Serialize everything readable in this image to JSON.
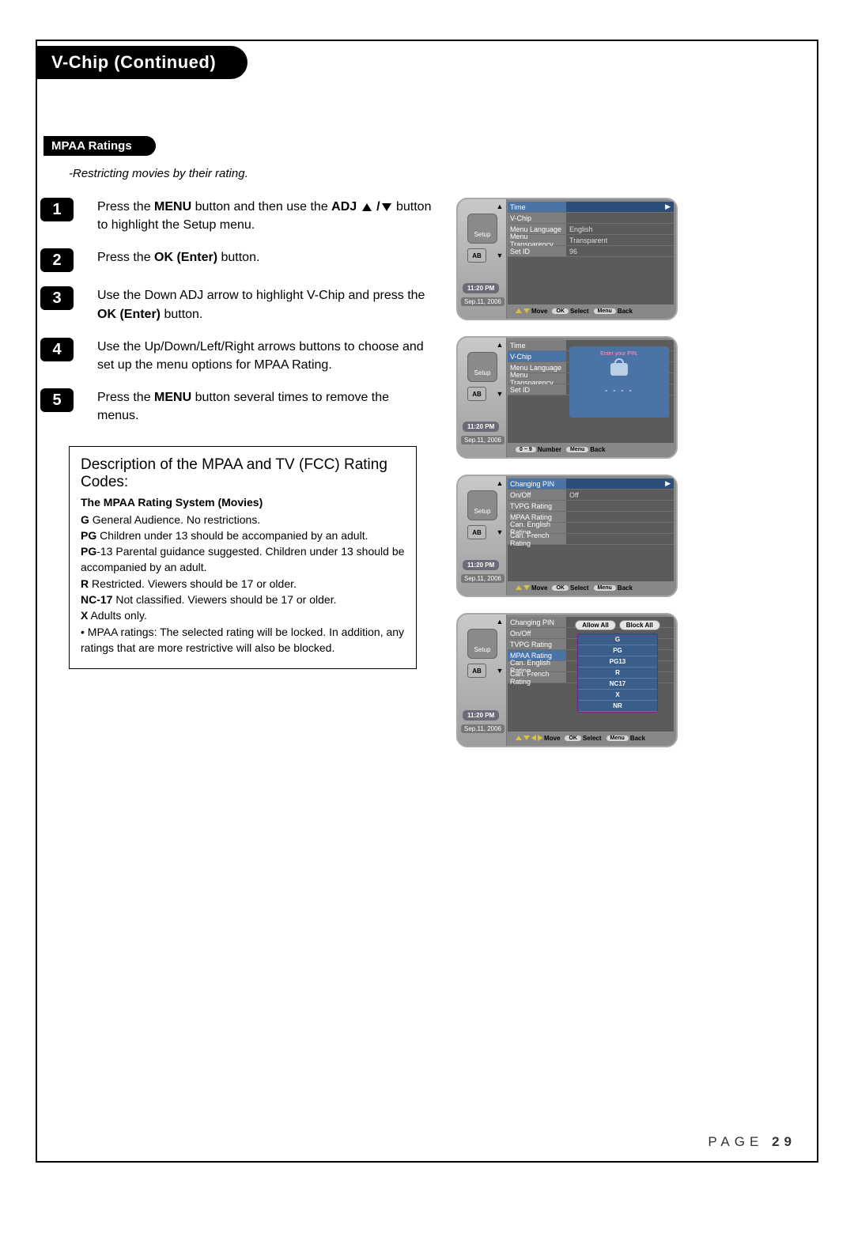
{
  "title": "V-Chip (Continued)",
  "section": "MPAA Ratings",
  "subtitle": "-Restricting movies by their rating.",
  "steps": {
    "s1a": "Press the ",
    "s1b": "MENU",
    "s1c": " button and then use the ",
    "s1d": "ADJ",
    "s1e": " button to highlight the Setup menu.",
    "s2a": "Press the ",
    "s2b": "OK (Enter)",
    "s2c": " button.",
    "s3a": "Use the Down ADJ arrow to highlight V-Chip and press the ",
    "s3b": "OK (Enter)",
    "s3c": " button.",
    "s4": "Use the Up/Down/Left/Right arrows buttons to choose and set up the menu options for MPAA Rating.",
    "s5a": "Press the ",
    "s5b": "MENU",
    "s5c": " button several times to remove the menus."
  },
  "desc": {
    "title": "Description of the MPAA and TV (FCC) Rating Codes:",
    "sub": "The MPAA Rating System (Movies)",
    "g_b": "G",
    "g_t": " General Audience. No restrictions.",
    "pg_b": "PG",
    "pg_t": " Children under 13 should be accompanied by an adult.",
    "pg13_b": "PG",
    "pg13_t": "-13 Parental guidance suggested. Children under 13 should be accompanied by an adult.",
    "r_b": "R",
    "r_t": " Restricted. Viewers should be 17 or older.",
    "nc_b": "NC-17",
    "nc_t": " Not classified. Viewers should be 17 or older.",
    "x_b": "X",
    "x_t": " Adults only.",
    "bullet": "• MPAA ratings: The selected rating will be locked. In addition, any ratings that are more restrictive will also be blocked."
  },
  "osd_common": {
    "setup": "Setup",
    "ab": "AB",
    "time": "11:20 PM",
    "date": "Sep.11, 2006",
    "move": "Move",
    "select": "Select",
    "menu": "Menu",
    "back": "Back",
    "ok": "OK",
    "number": "Number"
  },
  "osd1": {
    "r1": "Time",
    "r2": "V-Chip",
    "r3": "Menu Language",
    "v3": "English",
    "r4": "Menu Transparency",
    "v4": "Transparent",
    "r5": "Set ID",
    "v5": "96"
  },
  "osd2": {
    "r1": "Time",
    "r2": "V-Chip",
    "r3": "Menu Language",
    "r4": "Menu Transparency",
    "r5": "Set ID",
    "pin_title": "Enter your PIN.",
    "pin_dashes": "- - - -",
    "hint_num": "0 ~ 9"
  },
  "osd3": {
    "r1": "Changing PIN",
    "r2": "On/Off",
    "v2": "Off",
    "r3": "TVPG Rating",
    "r4": "MPAA Rating",
    "r5": "Can. English Rating",
    "r6": "Can. French Rating"
  },
  "osd4": {
    "r1": "Changing PIN",
    "r2": "On/Off",
    "r3": "TVPG Rating",
    "r4": "MPAA Rating",
    "r5": "Can. English Rating",
    "r6": "Can. French Rating",
    "allow": "Allow All",
    "block": "Block All",
    "g": "G",
    "pg": "PG",
    "pg13": "PG13",
    "r": "R",
    "nc17": "NC17",
    "x": "X",
    "nr": "NR"
  },
  "pagelabel": "PAGE",
  "pagenum": "29"
}
